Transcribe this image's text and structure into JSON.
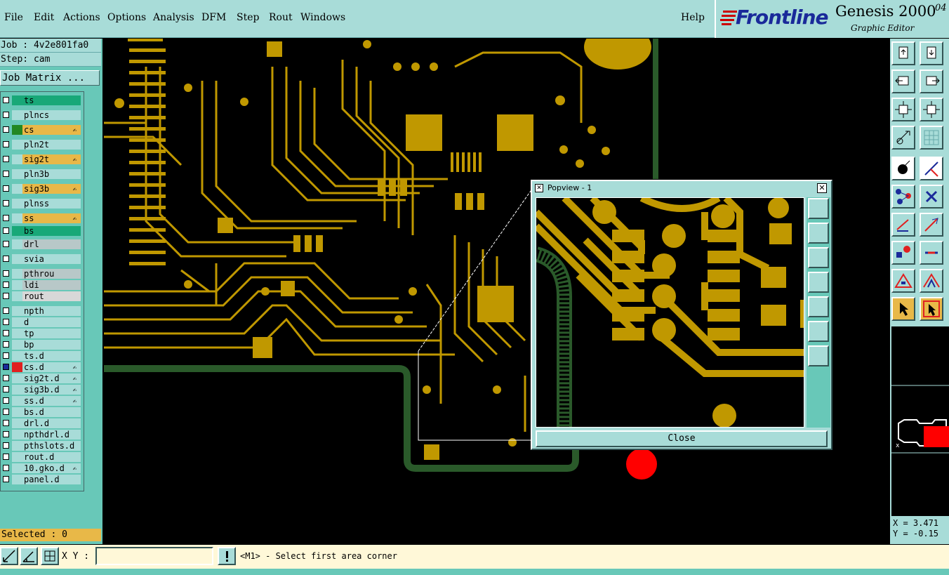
{
  "menu": [
    "File",
    "Edit",
    "Actions",
    "Options",
    "Analysis",
    "DFM",
    "Step",
    "Rout",
    "Windows"
  ],
  "help": "Help",
  "brand": {
    "logo": "Frontline",
    "product": "Genesis 2000",
    "subtitle": "Graphic Editor",
    "version": "04"
  },
  "job": {
    "job_line": "Job : 4v2e801fa0",
    "step_line": "Step: cam",
    "matrix_button": "Job Matrix ..."
  },
  "layers": [
    {
      "name": "ts",
      "bg": "#18a878",
      "swatch": "#18a878",
      "affected": false
    },
    {
      "name": "plncs",
      "bg": "#a8dcd8",
      "swatch": "#a8dcd8",
      "affected": false
    },
    {
      "name": "cs",
      "bg": "#e8b848",
      "swatch": "#228822",
      "affected": true
    },
    {
      "name": "pln2t",
      "bg": "#a8dcd8",
      "swatch": "#a8dcd8",
      "affected": false
    },
    {
      "name": "sig2t",
      "bg": "#e8b848",
      "swatch": "#a8dcd8",
      "affected": true
    },
    {
      "name": "pln3b",
      "bg": "#a8dcd8",
      "swatch": "#a8dcd8",
      "affected": false
    },
    {
      "name": "sig3b",
      "bg": "#e8b848",
      "swatch": "#a8dcd8",
      "affected": true
    },
    {
      "name": "plnss",
      "bg": "#a8dcd8",
      "swatch": "#a8dcd8",
      "affected": false
    },
    {
      "name": "ss",
      "bg": "#e8b848",
      "swatch": "#a8dcd8",
      "affected": true
    },
    {
      "name": "bs",
      "bg": "#18a878",
      "swatch": "#18a878",
      "affected": false
    },
    {
      "name": "drl",
      "bg": "#b8c8c8",
      "swatch": "#a8dcd8",
      "affected": false
    },
    {
      "name": "svia",
      "bg": "#a8dcd8",
      "swatch": "#a8dcd8",
      "affected": false
    },
    {
      "name": "pthrou",
      "bg": "#b8c8c8",
      "swatch": "#a8dcd8",
      "affected": false
    },
    {
      "name": "ldi",
      "bg": "#b8c8c8",
      "swatch": "#a8dcd8",
      "affected": false
    },
    {
      "name": "rout",
      "bg": "#d8d8d8",
      "swatch": "#a8dcd8",
      "affected": false
    },
    {
      "name": "npth",
      "bg": "#a8dcd8",
      "swatch": "#a8dcd8",
      "affected": false
    },
    {
      "name": "d",
      "bg": "#a8dcd8",
      "swatch": "#a8dcd8",
      "affected": false
    },
    {
      "name": "tp",
      "bg": "#a8dcd8",
      "swatch": "#a8dcd8",
      "affected": false
    },
    {
      "name": "bp",
      "bg": "#a8dcd8",
      "swatch": "#a8dcd8",
      "affected": false
    },
    {
      "name": "ts.d",
      "bg": "#a8dcd8",
      "swatch": "#a8dcd8",
      "affected": false
    },
    {
      "name": "cs.d",
      "bg": "#a8dcd8",
      "swatch": "#e02020",
      "affected": true,
      "active": true
    },
    {
      "name": "sig2t.d",
      "bg": "#a8dcd8",
      "swatch": "#a8dcd8",
      "affected": true
    },
    {
      "name": "sig3b.d",
      "bg": "#a8dcd8",
      "swatch": "#a8dcd8",
      "affected": true
    },
    {
      "name": "ss.d",
      "bg": "#a8dcd8",
      "swatch": "#a8dcd8",
      "affected": true
    },
    {
      "name": "bs.d",
      "bg": "#a8dcd8",
      "swatch": "#a8dcd8",
      "affected": false
    },
    {
      "name": "drl.d",
      "bg": "#a8dcd8",
      "swatch": "#a8dcd8",
      "affected": false
    },
    {
      "name": "npthdrl.d",
      "bg": "#a8dcd8",
      "swatch": "#a8dcd8",
      "affected": false
    },
    {
      "name": "pthslots.d",
      "bg": "#a8dcd8",
      "swatch": "#a8dcd8",
      "affected": false
    },
    {
      "name": "rout.d",
      "bg": "#a8dcd8",
      "swatch": "#a8dcd8",
      "affected": false
    },
    {
      "name": "10.gko.d",
      "bg": "#a8dcd8",
      "swatch": "#a8dcd8",
      "affected": true
    },
    {
      "name": "panel.d",
      "bg": "#a8dcd8",
      "swatch": "#a8dcd8",
      "affected": false
    }
  ],
  "selected_text": "Selected : 0",
  "statusbar": {
    "xy_label": "X Y :",
    "xy_value": "",
    "prompt": "<M1> - Select first area corner"
  },
  "coords": {
    "x": "X = 3.471",
    "y": "Y = -0.15"
  },
  "popup": {
    "title": "Popview - 1",
    "close_label": "Close"
  },
  "colors": {
    "copper": "#c09800",
    "panel": "#a8dcd8",
    "panel_dark": "#68c8b8",
    "orange": "#e8b848",
    "route": "#2a5a2a",
    "drill_red": "#ff0000"
  },
  "toolbar_icons": [
    "page-up-icon",
    "page-down-icon",
    "pan-left-icon",
    "pan-right-icon",
    "zoom-fit-icon",
    "zoom-center-icon",
    "measure-icon",
    "grid-icon",
    "feature-select-icon",
    "net-icon",
    "node-icon",
    "cross-icon",
    "line-add-icon",
    "line-edit-icon",
    "pad-add-icon",
    "minus-icon",
    "poly-add-icon",
    "poly-edit-icon",
    "pointer-icon",
    "pointer-box-icon"
  ]
}
